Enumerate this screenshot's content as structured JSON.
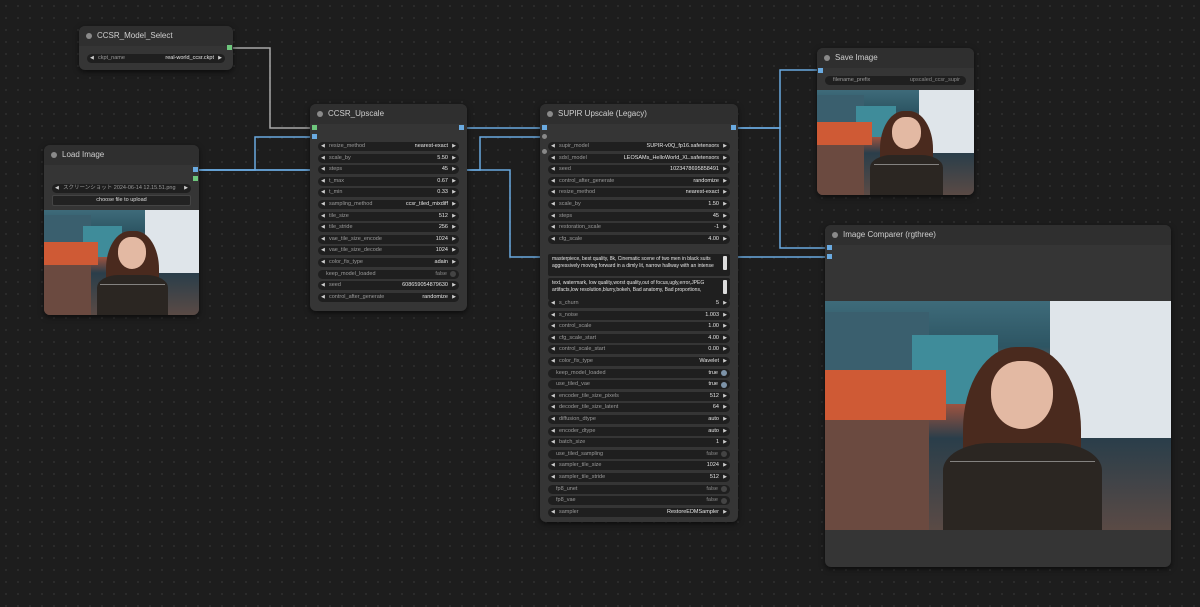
{
  "nodes": {
    "model_select": {
      "title": "CCSR_Model_Select",
      "widgets": [
        {
          "label": "ckpt_name",
          "value": "real-world_ccsr.ckpt"
        }
      ]
    },
    "load_image": {
      "title": "Load Image",
      "widgets": [
        {
          "label": "",
          "value": "スクリーンショット 2024-06-14 12.15.51.png"
        }
      ],
      "upload_label": "choose file to upload"
    },
    "ccsr_upscale": {
      "title": "CCSR_Upscale",
      "widgets": [
        {
          "label": "resize_method",
          "value": "nearest-exact"
        },
        {
          "label": "scale_by",
          "value": "5.50"
        },
        {
          "label": "steps",
          "value": "45"
        },
        {
          "label": "t_max",
          "value": "0.67"
        },
        {
          "label": "t_min",
          "value": "0.33"
        },
        {
          "label": "sampling_method",
          "value": "ccsr_tiled_mixdiff"
        },
        {
          "label": "tile_size",
          "value": "512"
        },
        {
          "label": "tile_stride",
          "value": "256"
        },
        {
          "label": "vae_tile_size_encode",
          "value": "1024"
        },
        {
          "label": "vae_tile_size_decode",
          "value": "1024"
        },
        {
          "label": "color_fix_type",
          "value": "adain"
        },
        {
          "label": "keep_model_loaded",
          "value": "false"
        },
        {
          "label": "seed",
          "value": "608659054879630"
        },
        {
          "label": "control_after_generate",
          "value": "randomize"
        }
      ]
    },
    "supir_upscale": {
      "title": "SUPIR Upscale (Legacy)",
      "widgets_top": [
        {
          "label": "supir_model",
          "value": "SUPIR-v0Q_fp16.safetensors"
        },
        {
          "label": "sdxl_model",
          "value": "LEOSAMs_HelloWorld_XL.safetensors"
        },
        {
          "label": "seed",
          "value": "1023478695858491"
        },
        {
          "label": "control_after_generate",
          "value": "randomize"
        },
        {
          "label": "resize_method",
          "value": "nearest-exact"
        },
        {
          "label": "scale_by",
          "value": "1.50"
        },
        {
          "label": "steps",
          "value": "45"
        },
        {
          "label": "restoration_scale",
          "value": "-1"
        },
        {
          "label": "cfg_scale",
          "value": "4.00"
        }
      ],
      "positive_prompt": "masterpiece, best quality, 8k, Cinematic scene of two men in black suits aggressively moving forward in a dimly lit, narrow hallway with an intense",
      "negative_prompt": "text, watermark, low quality,worst quality,out of focus,ugly,error,JPEG artifacts,low resolution,blurry,bokeh, Bad anatomy, Bad proportions,",
      "widgets_bottom": [
        {
          "label": "s_churn",
          "value": "5"
        },
        {
          "label": "s_noise",
          "value": "1.003"
        },
        {
          "label": "control_scale",
          "value": "1.00"
        },
        {
          "label": "cfg_scale_start",
          "value": "4.00"
        },
        {
          "label": "control_scale_start",
          "value": "0.00"
        },
        {
          "label": "color_fix_type",
          "value": "Wavelet"
        },
        {
          "label": "keep_model_loaded",
          "value": "true"
        },
        {
          "label": "use_tiled_vae",
          "value": "true"
        },
        {
          "label": "encoder_tile_size_pixels",
          "value": "512"
        },
        {
          "label": "decoder_tile_size_latent",
          "value": "64"
        },
        {
          "label": "diffusion_dtype",
          "value": "auto"
        },
        {
          "label": "encoder_dtype",
          "value": "auto"
        },
        {
          "label": "batch_size",
          "value": "1"
        },
        {
          "label": "use_tiled_sampling",
          "value": "false"
        },
        {
          "label": "sampler_tile_size",
          "value": "1024"
        },
        {
          "label": "sampler_tile_stride",
          "value": "512"
        },
        {
          "label": "fp8_unet",
          "value": "false"
        },
        {
          "label": "fp8_vae",
          "value": "false"
        },
        {
          "label": "sampler",
          "value": "RestoreEDMSampler"
        }
      ]
    },
    "save_image": {
      "title": "Save Image",
      "widgets": [
        {
          "label": "filename_prefix",
          "value": "upscaled_ccsr_supir"
        }
      ]
    },
    "image_comparer": {
      "title": "Image Comparer (rgthree)"
    }
  },
  "colors": {
    "wire_image": "#6aaae0",
    "wire_model": "#a8a8a8",
    "node_bg": "#353535",
    "widget_bg": "#1f1f1f"
  }
}
